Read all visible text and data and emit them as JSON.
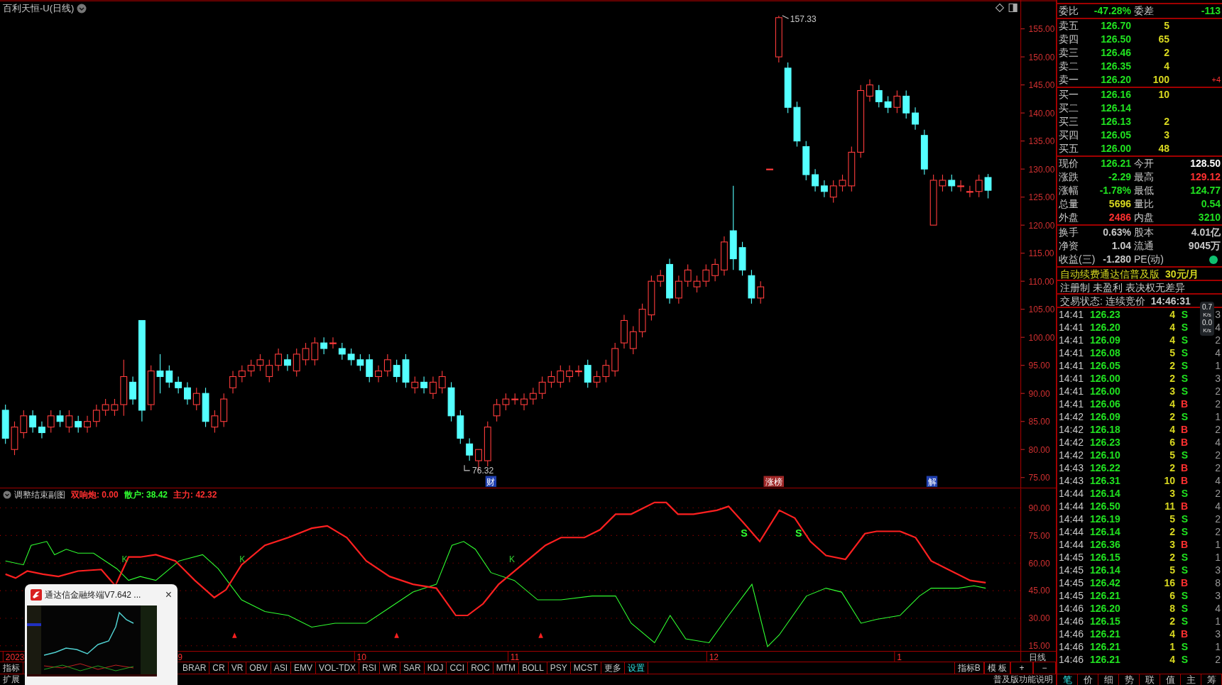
{
  "title": "百利天恒-U(日线)",
  "price_axis": [
    "155.00",
    "150.00",
    "145.00",
    "140.00",
    "135.00",
    "130.00",
    "125.00",
    "120.00",
    "115.00",
    "110.00",
    "105.00",
    "100.00",
    "95.00",
    "90.00",
    "85.00",
    "80.00",
    "75.00"
  ],
  "chart_data": {
    "type": "candlestick",
    "ohlc": [
      [
        87,
        88,
        81,
        82
      ],
      [
        80,
        85,
        79,
        84
      ],
      [
        83,
        87,
        82,
        86
      ],
      [
        86,
        87,
        83,
        84
      ],
      [
        84,
        85,
        82,
        83
      ],
      [
        84,
        87,
        83,
        86
      ],
      [
        86,
        87,
        84,
        85
      ],
      [
        84,
        87,
        83,
        86
      ],
      [
        85,
        86,
        83,
        84
      ],
      [
        84,
        86,
        83,
        85
      ],
      [
        85,
        88,
        84,
        87
      ],
      [
        87,
        89,
        86,
        88
      ],
      [
        87,
        89,
        86,
        88
      ],
      [
        88,
        96,
        86,
        93
      ],
      [
        92,
        93,
        88,
        89
      ],
      [
        103,
        103,
        85,
        87
      ],
      [
        88,
        95,
        87,
        94
      ],
      [
        94,
        97,
        90,
        93
      ],
      [
        94,
        95,
        91,
        92
      ],
      [
        92,
        93,
        90,
        91
      ],
      [
        91,
        92,
        88,
        89
      ],
      [
        88,
        91,
        87,
        90
      ],
      [
        90,
        91,
        84,
        85
      ],
      [
        84,
        87,
        83,
        86
      ],
      [
        85,
        90,
        84,
        89
      ],
      [
        91,
        94,
        90,
        93
      ],
      [
        93,
        95,
        92,
        94
      ],
      [
        94,
        96,
        93,
        95
      ],
      [
        95,
        97,
        94,
        96
      ],
      [
        93,
        96,
        92,
        95
      ],
      [
        95,
        98,
        94,
        97
      ],
      [
        96,
        97,
        94,
        95
      ],
      [
        94,
        98,
        93,
        97
      ],
      [
        96,
        99,
        95,
        98
      ],
      [
        96,
        100,
        95,
        99
      ],
      [
        99,
        100,
        97,
        98
      ],
      [
        99,
        100,
        98,
        99
      ],
      [
        98,
        99,
        96,
        97
      ],
      [
        97,
        98,
        95,
        96
      ],
      [
        96,
        97,
        94,
        95
      ],
      [
        96,
        97,
        92,
        93
      ],
      [
        93,
        95,
        92,
        94
      ],
      [
        94,
        97,
        93,
        96
      ],
      [
        95,
        96,
        92,
        93
      ],
      [
        96,
        97,
        91,
        92
      ],
      [
        91,
        93,
        90,
        92
      ],
      [
        92,
        93,
        90,
        91
      ],
      [
        90,
        93,
        89,
        92
      ],
      [
        91,
        94,
        90,
        93
      ],
      [
        91,
        92,
        85,
        86
      ],
      [
        86,
        87,
        81,
        82
      ],
      [
        81,
        82,
        78,
        79
      ],
      [
        78,
        80,
        76.32,
        80
      ],
      [
        78,
        85,
        77,
        84
      ],
      [
        86,
        89,
        85,
        88
      ],
      [
        88,
        90,
        87,
        89
      ],
      [
        89,
        90,
        88,
        89
      ],
      [
        88,
        90,
        87,
        89
      ],
      [
        89,
        91,
        88,
        90
      ],
      [
        90,
        93,
        89,
        92
      ],
      [
        92,
        94,
        91,
        93
      ],
      [
        92,
        95,
        91,
        94
      ],
      [
        93,
        95,
        92,
        94
      ],
      [
        94,
        95,
        93,
        94
      ],
      [
        95,
        96,
        91,
        92
      ],
      [
        92,
        94,
        91,
        93
      ],
      [
        93,
        96,
        92,
        95
      ],
      [
        94,
        99,
        93,
        98
      ],
      [
        99,
        104,
        98,
        103
      ],
      [
        98,
        102,
        97,
        101
      ],
      [
        101,
        106,
        100,
        105
      ],
      [
        104,
        111,
        103,
        110
      ],
      [
        110,
        112,
        109,
        111
      ],
      [
        113,
        114,
        106,
        107
      ],
      [
        107,
        111,
        106,
        110
      ],
      [
        110,
        113,
        109,
        112
      ],
      [
        109,
        111,
        108,
        110
      ],
      [
        110,
        113,
        109,
        112
      ],
      [
        111,
        114,
        110,
        113
      ],
      [
        112,
        118,
        111,
        117
      ],
      [
        119,
        127,
        112,
        114
      ],
      [
        116,
        117,
        111,
        112
      ],
      [
        111,
        112,
        106,
        107
      ],
      [
        107,
        110,
        106,
        109
      ],
      [
        130,
        130,
        130,
        130
      ],
      [
        150,
        157.33,
        149,
        157
      ],
      [
        148,
        149,
        140,
        141
      ],
      [
        141,
        142,
        134,
        135
      ],
      [
        134,
        135,
        128,
        129
      ],
      [
        129,
        130,
        126,
        127
      ],
      [
        127,
        128,
        125,
        126
      ],
      [
        125,
        128,
        124,
        127
      ],
      [
        127,
        129,
        126,
        128
      ],
      [
        127,
        134,
        126,
        133
      ],
      [
        133,
        145,
        132,
        144
      ],
      [
        143,
        146,
        142,
        145
      ],
      [
        144,
        145,
        141,
        142
      ],
      [
        142,
        143,
        140,
        141
      ],
      [
        141,
        144,
        140,
        143
      ],
      [
        143,
        144,
        139,
        140
      ],
      [
        140,
        141,
        137,
        138
      ],
      [
        136,
        137,
        129,
        130
      ],
      [
        120,
        129,
        120,
        128
      ],
      [
        127,
        129,
        126,
        128
      ],
      [
        128,
        129,
        126,
        127
      ],
      [
        127,
        128,
        126,
        127
      ],
      [
        126,
        127,
        125,
        126
      ],
      [
        126,
        129,
        125,
        128
      ],
      [
        128.5,
        129.12,
        124.77,
        126.21
      ]
    ]
  },
  "price_notes": [
    {
      "text": "157.33"
    },
    {
      "text": "76.32"
    }
  ],
  "event_marks": [
    {
      "text": "财",
      "color": "#2040b0"
    },
    {
      "text": "涨榜",
      "color": "#a02828"
    },
    {
      "text": "解",
      "color": "#2040b0"
    }
  ],
  "indicator": {
    "name": "调整结束副图",
    "readouts": [
      {
        "text": "双响炮: 0.00",
        "color": "#ff3030"
      },
      {
        "text": "散户: 38.42",
        "color": "#30ff30"
      },
      {
        "text": "主力: 42.32",
        "color": "#ff3030"
      }
    ],
    "axis": [
      "90.00",
      "75.00",
      "60.00",
      "45.00",
      "30.00",
      "15.00"
    ],
    "signals": [
      {
        "text": "K"
      },
      {
        "text": "K"
      },
      {
        "text": "K"
      },
      {
        "text": "S"
      },
      {
        "text": "S"
      }
    ]
  },
  "date_axis": [
    "2023",
    "9",
    "10",
    "11",
    "12",
    "1"
  ],
  "period": "日线",
  "indicator_tabs": [
    {
      "label": "指标",
      "selected": false
    },
    {
      "label": "BRAR",
      "selected": false
    },
    {
      "label": "CR",
      "selected": false
    },
    {
      "label": "VR",
      "selected": false
    },
    {
      "label": "OBV",
      "selected": false
    },
    {
      "label": "ASI",
      "selected": false
    },
    {
      "label": "EMV",
      "selected": false
    },
    {
      "label": "VOL-TDX",
      "selected": false
    },
    {
      "label": "RSI",
      "selected": false
    },
    {
      "label": "WR",
      "selected": false
    },
    {
      "label": "SAR",
      "selected": false
    },
    {
      "label": "KDJ",
      "selected": false
    },
    {
      "label": "CCI",
      "selected": false
    },
    {
      "label": "ROC",
      "selected": false
    },
    {
      "label": "MTM",
      "selected": false
    },
    {
      "label": "BOLL",
      "selected": false
    },
    {
      "label": "PSY",
      "selected": false
    },
    {
      "label": "MCST",
      "selected": false
    },
    {
      "label": "更多",
      "selected": false
    },
    {
      "label": "设置",
      "selected": true
    }
  ],
  "chart_tools": [
    "指标B",
    "模 板",
    "+",
    "−"
  ],
  "expand_label": "扩展",
  "notice": "普及版功能说明",
  "quote_tabs": [
    {
      "label": "笔",
      "selected": true
    },
    {
      "label": "价",
      "selected": false
    },
    {
      "label": "细",
      "selected": false
    },
    {
      "label": "势",
      "selected": false
    },
    {
      "label": "联",
      "selected": false
    },
    {
      "label": "值",
      "selected": false
    },
    {
      "label": "主",
      "selected": false
    },
    {
      "label": "筹",
      "selected": false
    }
  ],
  "order_ratio": {
    "label": "委比",
    "value": "-47.28%",
    "label2": "委差",
    "value2": "-113"
  },
  "asks": [
    {
      "label": "卖五",
      "price": "126.70",
      "volume": "5"
    },
    {
      "label": "卖四",
      "price": "126.50",
      "volume": "65"
    },
    {
      "label": "卖三",
      "price": "126.46",
      "volume": "2"
    },
    {
      "label": "卖二",
      "price": "126.35",
      "volume": "4"
    },
    {
      "label": "卖一",
      "price": "126.20",
      "volume": "100",
      "change": "+4"
    }
  ],
  "bids": [
    {
      "label": "买一",
      "price": "126.16",
      "volume": "10"
    },
    {
      "label": "买二",
      "price": "126.14"
    },
    {
      "label": "买三",
      "price": "126.13",
      "volume": "2"
    },
    {
      "label": "买四",
      "price": "126.05",
      "volume": "3"
    },
    {
      "label": "买五",
      "price": "126.00",
      "volume": "48"
    }
  ],
  "stats": [
    [
      {
        "label": "现价",
        "value": "126.21",
        "color": "#20e020"
      },
      {
        "label": "今开",
        "value": "128.50",
        "color": "#ffffff"
      }
    ],
    [
      {
        "label": "涨跌",
        "value": "-2.29",
        "color": "#20e020"
      },
      {
        "label": "最高",
        "value": "129.12",
        "color": "#ff3030"
      }
    ],
    [
      {
        "label": "涨幅",
        "value": "-1.78%",
        "color": "#20e020"
      },
      {
        "label": "最低",
        "value": "124.77",
        "color": "#20e020"
      }
    ],
    [
      {
        "label": "总量",
        "value": "5696",
        "color": "#d8d820"
      },
      {
        "label": "量比",
        "value": "0.54",
        "color": "#20e020"
      }
    ],
    [
      {
        "label": "外盘",
        "value": "2486",
        "color": "#ff3030"
      },
      {
        "label": "内盘",
        "value": "3210",
        "color": "#20e020"
      }
    ]
  ],
  "fundamentals": [
    {
      "label": "换手",
      "value": "0.63%",
      "label2": "股本",
      "value2": "4.01亿"
    },
    {
      "label": "净资",
      "value": "1.04",
      "label2": "流通",
      "value2": "9045万"
    },
    {
      "label": "收益(三)",
      "value": "-1.280",
      "label2": "PE(动)"
    }
  ],
  "promo": {
    "text": "自动续费通达信普及版",
    "price": "30元/月"
  },
  "tags": "注册制 未盈利 表决权无差异",
  "trade_status": {
    "label": "交易状态: 连续竞价",
    "time": "14:46:31"
  },
  "trades": [
    {
      "time": "14:41",
      "price": "126.23",
      "volume": "4",
      "side": "S",
      "buy": false,
      "count": "3"
    },
    {
      "time": "14:41",
      "price": "126.20",
      "volume": "4",
      "side": "S",
      "buy": false,
      "count": "4"
    },
    {
      "time": "14:41",
      "price": "126.09",
      "volume": "4",
      "side": "S",
      "buy": false,
      "count": "2"
    },
    {
      "time": "14:41",
      "price": "126.08",
      "volume": "5",
      "side": "S",
      "buy": false,
      "count": "4"
    },
    {
      "time": "14:41",
      "price": "126.05",
      "volume": "2",
      "side": "S",
      "buy": false,
      "count": "1"
    },
    {
      "time": "14:41",
      "price": "126.00",
      "volume": "2",
      "side": "S",
      "buy": false,
      "count": "3"
    },
    {
      "time": "14:41",
      "price": "126.00",
      "volume": "3",
      "side": "S",
      "buy": false,
      "count": "2"
    },
    {
      "time": "14:41",
      "price": "126.06",
      "volume": "4",
      "side": "B",
      "buy": true,
      "count": "2"
    },
    {
      "time": "14:42",
      "price": "126.09",
      "volume": "2",
      "side": "S",
      "buy": false,
      "count": "1"
    },
    {
      "time": "14:42",
      "price": "126.18",
      "volume": "4",
      "side": "B",
      "buy": true,
      "count": "2"
    },
    {
      "time": "14:42",
      "price": "126.23",
      "volume": "6",
      "side": "B",
      "buy": true,
      "count": "4"
    },
    {
      "time": "14:42",
      "price": "126.10",
      "volume": "5",
      "side": "S",
      "buy": false,
      "count": "2"
    },
    {
      "time": "14:43",
      "price": "126.22",
      "volume": "2",
      "side": "B",
      "buy": true,
      "count": "2"
    },
    {
      "time": "14:43",
      "price": "126.31",
      "volume": "10",
      "side": "B",
      "buy": true,
      "count": "4"
    },
    {
      "time": "14:44",
      "price": "126.14",
      "volume": "3",
      "side": "S",
      "buy": false,
      "count": "2"
    },
    {
      "time": "14:44",
      "price": "126.50",
      "volume": "11",
      "side": "B",
      "buy": true,
      "count": "4"
    },
    {
      "time": "14:44",
      "price": "126.19",
      "volume": "5",
      "side": "S",
      "buy": false,
      "count": "2"
    },
    {
      "time": "14:44",
      "price": "126.14",
      "volume": "2",
      "side": "S",
      "buy": false,
      "count": "2"
    },
    {
      "time": "14:44",
      "price": "126.36",
      "volume": "3",
      "side": "B",
      "buy": true,
      "count": "1"
    },
    {
      "time": "14:45",
      "price": "126.15",
      "volume": "2",
      "side": "S",
      "buy": false,
      "count": "1"
    },
    {
      "time": "14:45",
      "price": "126.14",
      "volume": "5",
      "side": "S",
      "buy": false,
      "count": "3"
    },
    {
      "time": "14:45",
      "price": "126.42",
      "volume": "16",
      "side": "B",
      "buy": true,
      "count": "8"
    },
    {
      "time": "14:45",
      "price": "126.21",
      "volume": "6",
      "side": "S",
      "buy": false,
      "count": "3"
    },
    {
      "time": "14:46",
      "price": "126.20",
      "volume": "8",
      "side": "S",
      "buy": false,
      "count": "4"
    },
    {
      "time": "14:46",
      "price": "126.15",
      "volume": "2",
      "side": "S",
      "buy": false,
      "count": "1"
    },
    {
      "time": "14:46",
      "price": "126.21",
      "volume": "4",
      "side": "B",
      "buy": true,
      "count": "3"
    },
    {
      "time": "14:46",
      "price": "126.21",
      "volume": "1",
      "side": "S",
      "buy": false,
      "count": "1"
    },
    {
      "time": "14:46",
      "price": "126.21",
      "volume": "4",
      "side": "S",
      "buy": false,
      "count": "2"
    }
  ],
  "net_widget": {
    "up": "0.7",
    "up_unit": "K/s",
    "down": "0.0",
    "down_unit": "K/s"
  },
  "popup": {
    "title": "通达信金融终端V7.642 ...",
    "close": "×",
    "kind": "picture"
  }
}
